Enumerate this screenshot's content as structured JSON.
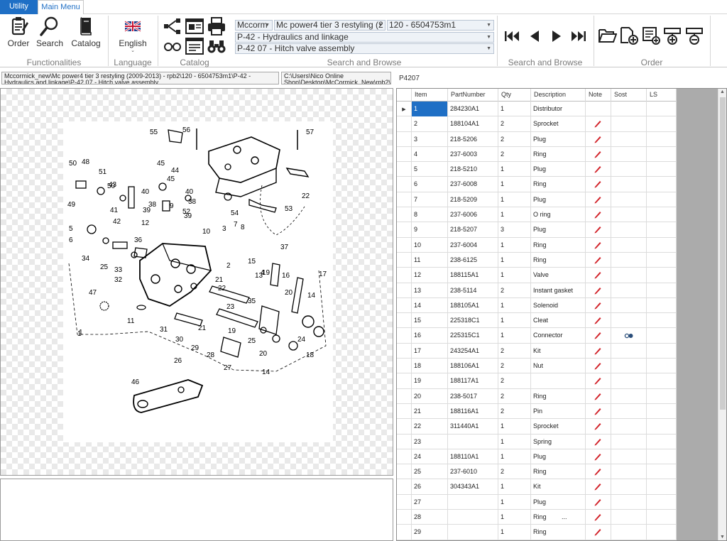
{
  "tabs": {
    "utility": "Utility",
    "main_menu": "Main Menu"
  },
  "ribbon": {
    "functionalities": {
      "label": "Functionalities",
      "order": "Order",
      "search": "Search",
      "catalog": "Catalog"
    },
    "language": {
      "label": "Language",
      "current": "English"
    },
    "catalog": {
      "label": "Catalog"
    },
    "browse_selectors": {
      "label": "Search and Browse",
      "brand": "Mccorm",
      "model": "Mc power4 tier 3 restyling (2",
      "serial": "120 - 6504753m1",
      "group": "P-42 - Hydraulics and linkage",
      "page": "P-42 07 - Hitch valve assembly"
    },
    "navigation": {
      "label": "Search and Browse"
    },
    "order": {
      "label": "Order"
    }
  },
  "path_bar": {
    "catalog_path": "Mccormick_new\\Mc power4 tier 3 restyling (2009-2013) - rpb2\\120 - 6504753m1\\P-42 - Hydraulics and linkage\\P-42 07 - Hitch valve assembly",
    "file_path": "C:\\Users\\Nico Online Shop\\Desktop\\McCormick_New\\rpb2\\Tiff",
    "page_code": "P4207"
  },
  "grid": {
    "columns": [
      "Item",
      "PartNumber",
      "Qty",
      "Description",
      "Note",
      "Sost",
      "LS"
    ],
    "rows": [
      {
        "item": "1",
        "part": "284230A1",
        "qty": "1",
        "desc": "Distributor",
        "note": false,
        "sost": false
      },
      {
        "item": "2",
        "part": "188104A1",
        "qty": "2",
        "desc": "Sprocket",
        "note": true,
        "sost": false
      },
      {
        "item": "3",
        "part": "218-5206",
        "qty": "2",
        "desc": "Plug",
        "note": true,
        "sost": false
      },
      {
        "item": "4",
        "part": "237-6003",
        "qty": "2",
        "desc": "Ring",
        "note": true,
        "sost": false
      },
      {
        "item": "5",
        "part": "218-5210",
        "qty": "1",
        "desc": "Plug",
        "note": true,
        "sost": false
      },
      {
        "item": "6",
        "part": "237-6008",
        "qty": "1",
        "desc": "Ring",
        "note": true,
        "sost": false
      },
      {
        "item": "7",
        "part": "218-5209",
        "qty": "1",
        "desc": "Plug",
        "note": true,
        "sost": false
      },
      {
        "item": "8",
        "part": "237-6006",
        "qty": "1",
        "desc": "O ring",
        "note": true,
        "sost": false
      },
      {
        "item": "9",
        "part": "218-5207",
        "qty": "3",
        "desc": "Plug",
        "note": true,
        "sost": false
      },
      {
        "item": "10",
        "part": "237-6004",
        "qty": "1",
        "desc": "Ring",
        "note": true,
        "sost": false
      },
      {
        "item": "11",
        "part": "238-6125",
        "qty": "1",
        "desc": "Ring",
        "note": true,
        "sost": false
      },
      {
        "item": "12",
        "part": "188115A1",
        "qty": "1",
        "desc": "Valve",
        "note": true,
        "sost": false
      },
      {
        "item": "13",
        "part": "238-5114",
        "qty": "2",
        "desc": "Instant gasket",
        "note": true,
        "sost": false
      },
      {
        "item": "14",
        "part": "188105A1",
        "qty": "1",
        "desc": "Solenoid",
        "note": true,
        "sost": false
      },
      {
        "item": "15",
        "part": "225318C1",
        "qty": "1",
        "desc": "Cleat",
        "note": true,
        "sost": false
      },
      {
        "item": "16",
        "part": "225315C1",
        "qty": "1",
        "desc": "Connector",
        "note": true,
        "sost": true
      },
      {
        "item": "17",
        "part": "243254A1",
        "qty": "2",
        "desc": "Kit",
        "note": true,
        "sost": false
      },
      {
        "item": "18",
        "part": "188106A1",
        "qty": "2",
        "desc": "Nut",
        "note": true,
        "sost": false
      },
      {
        "item": "19",
        "part": "188117A1",
        "qty": "2",
        "desc": "",
        "note": true,
        "sost": false
      },
      {
        "item": "20",
        "part": "238-5017",
        "qty": "2",
        "desc": "Ring",
        "note": true,
        "sost": false
      },
      {
        "item": "21",
        "part": "188116A1",
        "qty": "2",
        "desc": "Pin",
        "note": true,
        "sost": false
      },
      {
        "item": "22",
        "part": "311440A1",
        "qty": "1",
        "desc": "Sprocket",
        "note": true,
        "sost": false
      },
      {
        "item": "23",
        "part": "",
        "qty": "1",
        "desc": "Spring",
        "note": true,
        "sost": false
      },
      {
        "item": "24",
        "part": "188110A1",
        "qty": "1",
        "desc": "Plug",
        "note": true,
        "sost": false
      },
      {
        "item": "25",
        "part": "237-6010",
        "qty": "2",
        "desc": "Ring",
        "note": true,
        "sost": false
      },
      {
        "item": "26",
        "part": "304343A1",
        "qty": "1",
        "desc": "Kit",
        "note": true,
        "sost": false
      },
      {
        "item": "27",
        "part": "",
        "qty": "1",
        "desc": "Plug",
        "note": true,
        "sost": false
      },
      {
        "item": "28",
        "part": "",
        "qty": "1",
        "desc": "Ring",
        "note": true,
        "sost": false
      },
      {
        "item": "29",
        "part": "",
        "qty": "1",
        "desc": "Ring",
        "note": true,
        "sost": false
      }
    ],
    "row_28_extra": "...",
    "selected_row": 0
  },
  "drawing": {
    "callouts": [
      "55",
      "56",
      "57",
      "50",
      "48",
      "45",
      "44",
      "51",
      "50",
      "43",
      "22",
      "40",
      "45",
      "38",
      "53",
      "49",
      "41",
      "40",
      "38",
      "9",
      "39",
      "54",
      "52",
      "39",
      "5",
      "42",
      "12",
      "10",
      "3",
      "8",
      "7",
      "36",
      "6",
      "34",
      "25",
      "33",
      "32",
      "37",
      "15",
      "13",
      "21",
      "2",
      "4",
      "1",
      "19",
      "17",
      "47",
      "16",
      "20",
      "14",
      "11",
      "22",
      "23",
      "35",
      "31",
      "30",
      "21",
      "19",
      "24",
      "29",
      "28",
      "25",
      "20",
      "18",
      "26",
      "27",
      "14",
      "1",
      "46"
    ]
  },
  "colors": {
    "accent": "#1f6fc5",
    "note_pencil": "#d2232a",
    "sost_dot": "#2a4e7a"
  }
}
